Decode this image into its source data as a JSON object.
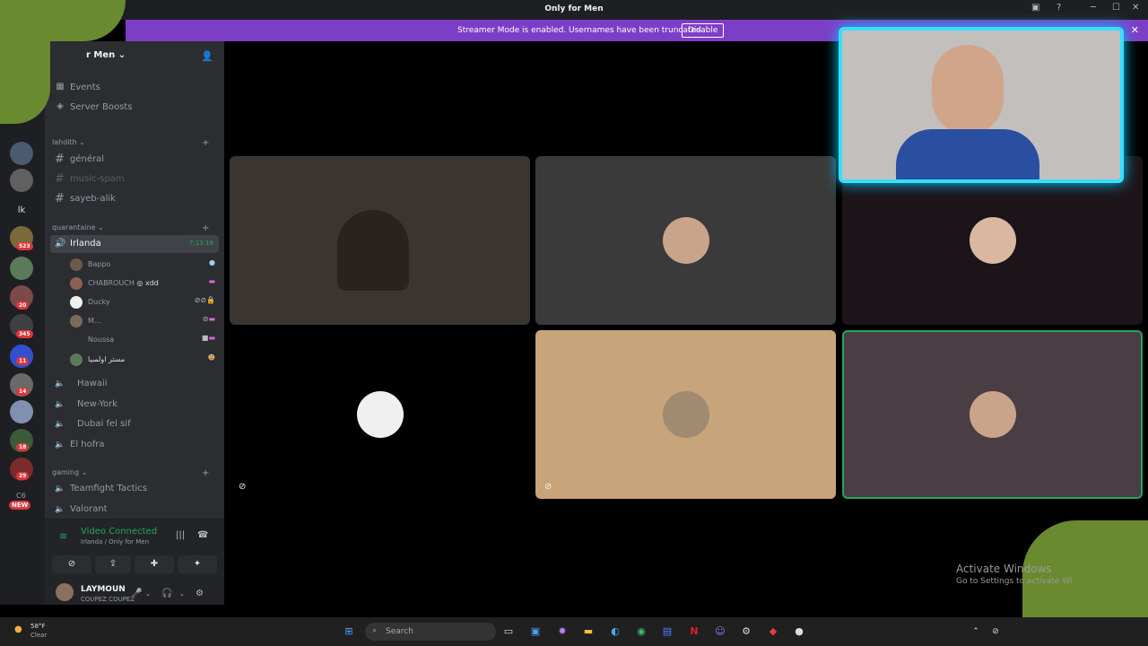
{
  "window": {
    "title": "Only for Men"
  },
  "banner": {
    "message": "Streamer Mode is enabled. Usernames have been truncated.",
    "disable_label": "Disable"
  },
  "server": {
    "name": "r Men"
  },
  "top_items": [
    {
      "label": "Events",
      "icon": "calendar-icon"
    },
    {
      "label": "Server Boosts",
      "icon": "boost-icon"
    }
  ],
  "categories": {
    "lahdith": "lahdith",
    "quarantaine": "quarantaine",
    "gaming": "gaming"
  },
  "text_channels": [
    {
      "label": "général",
      "muted": false
    },
    {
      "label": "music-spam",
      "muted": true
    },
    {
      "label": "sayeb-alik",
      "muted": false
    }
  ],
  "active_voice": {
    "label": "Irlanda",
    "timer": "7:13:18"
  },
  "members": [
    {
      "name": "Bappo"
    },
    {
      "name": "CHABROUCH",
      "tag": "xdd"
    },
    {
      "name": "Ducky"
    },
    {
      "name": "M..."
    },
    {
      "name": "Noussa"
    },
    {
      "name": "مستر اولمبيا"
    }
  ],
  "voice_channels": [
    {
      "label": "Hawaii"
    },
    {
      "label": "New-York"
    },
    {
      "label": "Dubai fel sif"
    },
    {
      "label": "El hofra"
    }
  ],
  "gaming_channels": [
    {
      "label": "Teamfight Tactics"
    },
    {
      "label": "Valorant"
    }
  ],
  "servers_badges": [
    "523",
    "20",
    "345",
    "11",
    "14",
    "18",
    "29",
    "NEW"
  ],
  "server_initials": [
    "lk",
    "C6"
  ],
  "voice_panel": {
    "title": "Video Connected",
    "subtitle": "Irlanda / Only for Men"
  },
  "user": {
    "name": "LAYMOUN",
    "status": "COUPEZ COUPEZ"
  },
  "activate": {
    "line1": "Activate Windows",
    "line2": "Go to Settings to activate Wi"
  },
  "taskbar": {
    "search_label": "Search",
    "temp": "58°F",
    "condition": "Clear"
  },
  "colors": {
    "accent_green": "#23a55a",
    "banner": "#7d3ec7",
    "cam_glow": "#34e0ff"
  }
}
